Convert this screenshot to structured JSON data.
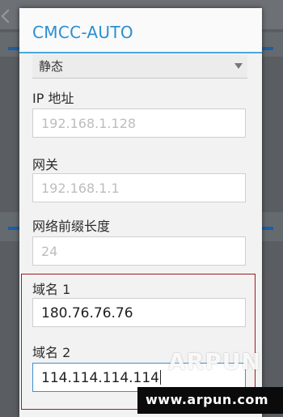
{
  "dialog": {
    "title": "CMCC-AUTO",
    "ip_settings_value": "静态",
    "fields": [
      {
        "label": "IP 地址",
        "placeholder": "192.168.1.128",
        "value": ""
      },
      {
        "label": "网关",
        "placeholder": "192.168.1.1",
        "value": ""
      },
      {
        "label": "网络前缀长度",
        "placeholder": "24",
        "value": ""
      },
      {
        "label": "域名 1",
        "placeholder": "",
        "value": "180.76.76.76"
      },
      {
        "label": "域名 2",
        "placeholder": "",
        "value": "114.114.114.114"
      }
    ]
  },
  "watermark": {
    "logo_text": "ARPUN",
    "url": "www.arpun.com"
  },
  "colors": {
    "title_text": "#2a8fd2",
    "title_divider": "#4aa8dc",
    "highlight_box": "#9b1d1d",
    "focus_border": "#3f8fd0"
  }
}
